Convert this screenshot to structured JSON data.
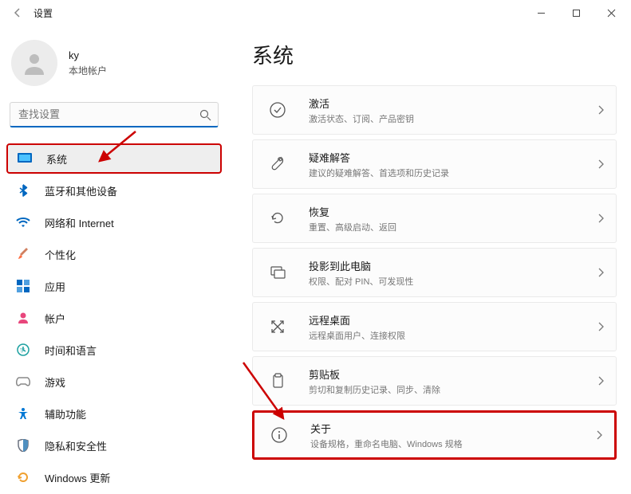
{
  "window": {
    "title": "设置"
  },
  "profile": {
    "name": "ky",
    "subtitle": "本地帐户"
  },
  "search": {
    "placeholder": "查找设置"
  },
  "sidebar": {
    "items": [
      {
        "label": "系统",
        "icon": "system",
        "selected": true
      },
      {
        "label": "蓝牙和其他设备",
        "icon": "bluetooth"
      },
      {
        "label": "网络和 Internet",
        "icon": "wifi"
      },
      {
        "label": "个性化",
        "icon": "brush"
      },
      {
        "label": "应用",
        "icon": "apps"
      },
      {
        "label": "帐户",
        "icon": "person"
      },
      {
        "label": "时间和语言",
        "icon": "time-language"
      },
      {
        "label": "游戏",
        "icon": "game"
      },
      {
        "label": "辅助功能",
        "icon": "accessibility"
      },
      {
        "label": "隐私和安全性",
        "icon": "shield"
      },
      {
        "label": "Windows 更新",
        "icon": "update"
      }
    ]
  },
  "content": {
    "title": "系统",
    "cards": [
      {
        "title": "激活",
        "subtitle": "激活状态、订阅、产品密钥",
        "icon": "check-circle"
      },
      {
        "title": "疑难解答",
        "subtitle": "建议的疑难解答、首选项和历史记录",
        "icon": "wrench"
      },
      {
        "title": "恢复",
        "subtitle": "重置、高级启动、返回",
        "icon": "recovery"
      },
      {
        "title": "投影到此电脑",
        "subtitle": "权限、配对 PIN、可发现性",
        "icon": "project"
      },
      {
        "title": "远程桌面",
        "subtitle": "远程桌面用户、连接权限",
        "icon": "remote"
      },
      {
        "title": "剪贴板",
        "subtitle": "剪切和复制历史记录、同步、清除",
        "icon": "clipboard"
      },
      {
        "title": "关于",
        "subtitle": "设备规格，重命名电脑、Windows 规格",
        "icon": "info"
      }
    ]
  }
}
